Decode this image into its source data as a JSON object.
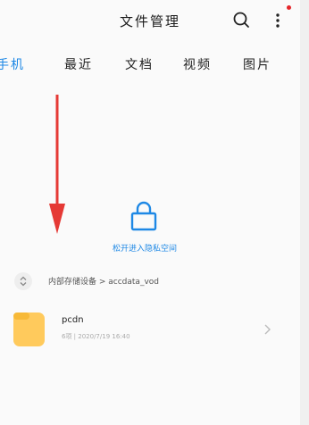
{
  "header": {
    "title": "文件管理",
    "icons": [
      "search-icon",
      "more-vertical-icon"
    ],
    "notification_dot_color": "#e5252a"
  },
  "tabs": [
    {
      "label": "手机",
      "active": true
    },
    {
      "label": "最近",
      "active": false
    },
    {
      "label": "文档",
      "active": false
    },
    {
      "label": "视频",
      "active": false
    },
    {
      "label": "图片",
      "active": false
    }
  ],
  "private_space": {
    "text": "松开进入隐私空间",
    "icon": "lock-icon"
  },
  "breadcrumb": {
    "path": "内部存储设备 > accdata_vod",
    "icon": "expand-collapse-icon"
  },
  "files": [
    {
      "name": "pcdn",
      "meta": "6项 | 2020/7/19 16:40",
      "icon": "folder-icon"
    }
  ],
  "colors": {
    "accent": "#1e88e5",
    "arrow": "#e53935",
    "folder": "#ffca5c"
  }
}
